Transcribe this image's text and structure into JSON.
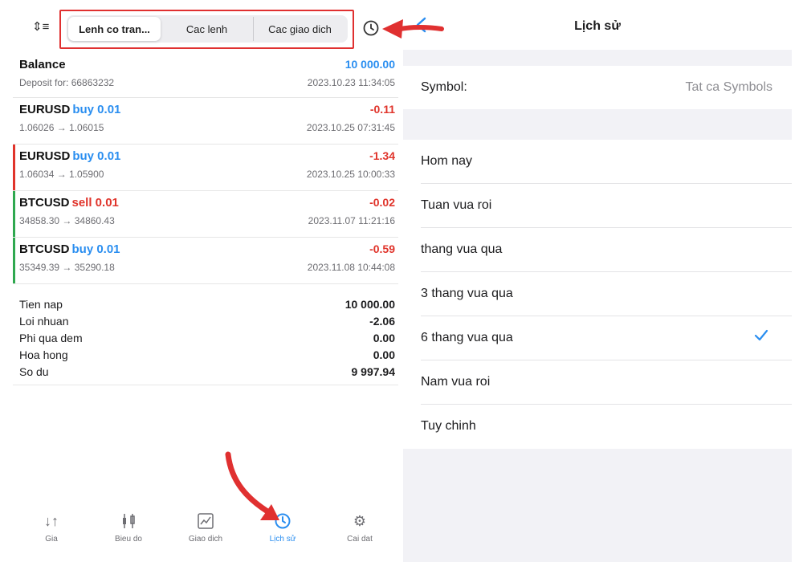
{
  "segment": {
    "tabs": [
      {
        "label": "Lenh co tran...",
        "active": true
      },
      {
        "label": "Cac lenh",
        "active": false
      },
      {
        "label": "Cac giao dich",
        "active": false
      }
    ]
  },
  "deals": [
    {
      "symbol": "Balance",
      "direction": "",
      "direction_color": "",
      "value": "10 000.00",
      "value_color": "#2a8ef0",
      "sub": "Deposit for: 66863232",
      "time": "2023.10.23 11:34:05",
      "bar_color": ""
    },
    {
      "symbol": "EURUSD",
      "direction": "buy 0.01",
      "direction_color": "#2a8ef0",
      "value": "-0.11",
      "value_color": "#e0342b",
      "sub": "1.06026 → 1.06015",
      "time": "2023.10.25 07:31:45",
      "bar_color": ""
    },
    {
      "symbol": "EURUSD",
      "direction": "buy 0.01",
      "direction_color": "#2a8ef0",
      "value": "-1.34",
      "value_color": "#e0342b",
      "sub": "1.06034 → 1.05900",
      "time": "2023.10.25 10:00:33",
      "bar_color": "#e0342b"
    },
    {
      "symbol": "BTCUSD",
      "direction": "sell 0.01",
      "direction_color": "#e0342b",
      "value": "-0.02",
      "value_color": "#e0342b",
      "sub": "34858.30 → 34860.43",
      "time": "2023.11.07 11:21:16",
      "bar_color": "#2fa84f"
    },
    {
      "symbol": "BTCUSD",
      "direction": "buy 0.01",
      "direction_color": "#2a8ef0",
      "value": "-0.59",
      "value_color": "#e0342b",
      "sub": "35349.39 → 35290.18",
      "time": "2023.11.08 10:44:08",
      "bar_color": "#2fa84f"
    }
  ],
  "summary": [
    {
      "label": "Tien nap",
      "value": "10 000.00"
    },
    {
      "label": "Loi nhuan",
      "value": "-2.06"
    },
    {
      "label": "Phi qua dem",
      "value": "0.00"
    },
    {
      "label": "Hoa hong",
      "value": "0.00"
    },
    {
      "label": "So du",
      "value": "9 997.94"
    }
  ],
  "tabbar": [
    {
      "label": "Gia",
      "icon": "arrows-updown-icon",
      "active": false
    },
    {
      "label": "Bieu do",
      "icon": "candlestick-icon",
      "active": false
    },
    {
      "label": "Giao dich",
      "icon": "trade-chart-icon",
      "active": false
    },
    {
      "label": "Lịch sử",
      "icon": "history-clock-icon",
      "active": true
    },
    {
      "label": "Cai dat",
      "icon": "gear-icon",
      "active": false
    }
  ],
  "history": {
    "title": "Lịch sử",
    "symbol_label": "Symbol:",
    "symbol_value": "Tat ca Symbols",
    "periods": [
      {
        "label": "Hom nay",
        "selected": false
      },
      {
        "label": "Tuan vua roi",
        "selected": false
      },
      {
        "label": "thang vua qua",
        "selected": false
      },
      {
        "label": "3 thang vua qua",
        "selected": false
      },
      {
        "label": "6 thang vua qua",
        "selected": true
      },
      {
        "label": "Nam vua roi",
        "selected": false
      },
      {
        "label": "Tuy chinh",
        "selected": false
      }
    ]
  },
  "colors": {
    "accent": "#2a8ef0",
    "loss": "#e0342b",
    "annotation": "#e03030"
  }
}
